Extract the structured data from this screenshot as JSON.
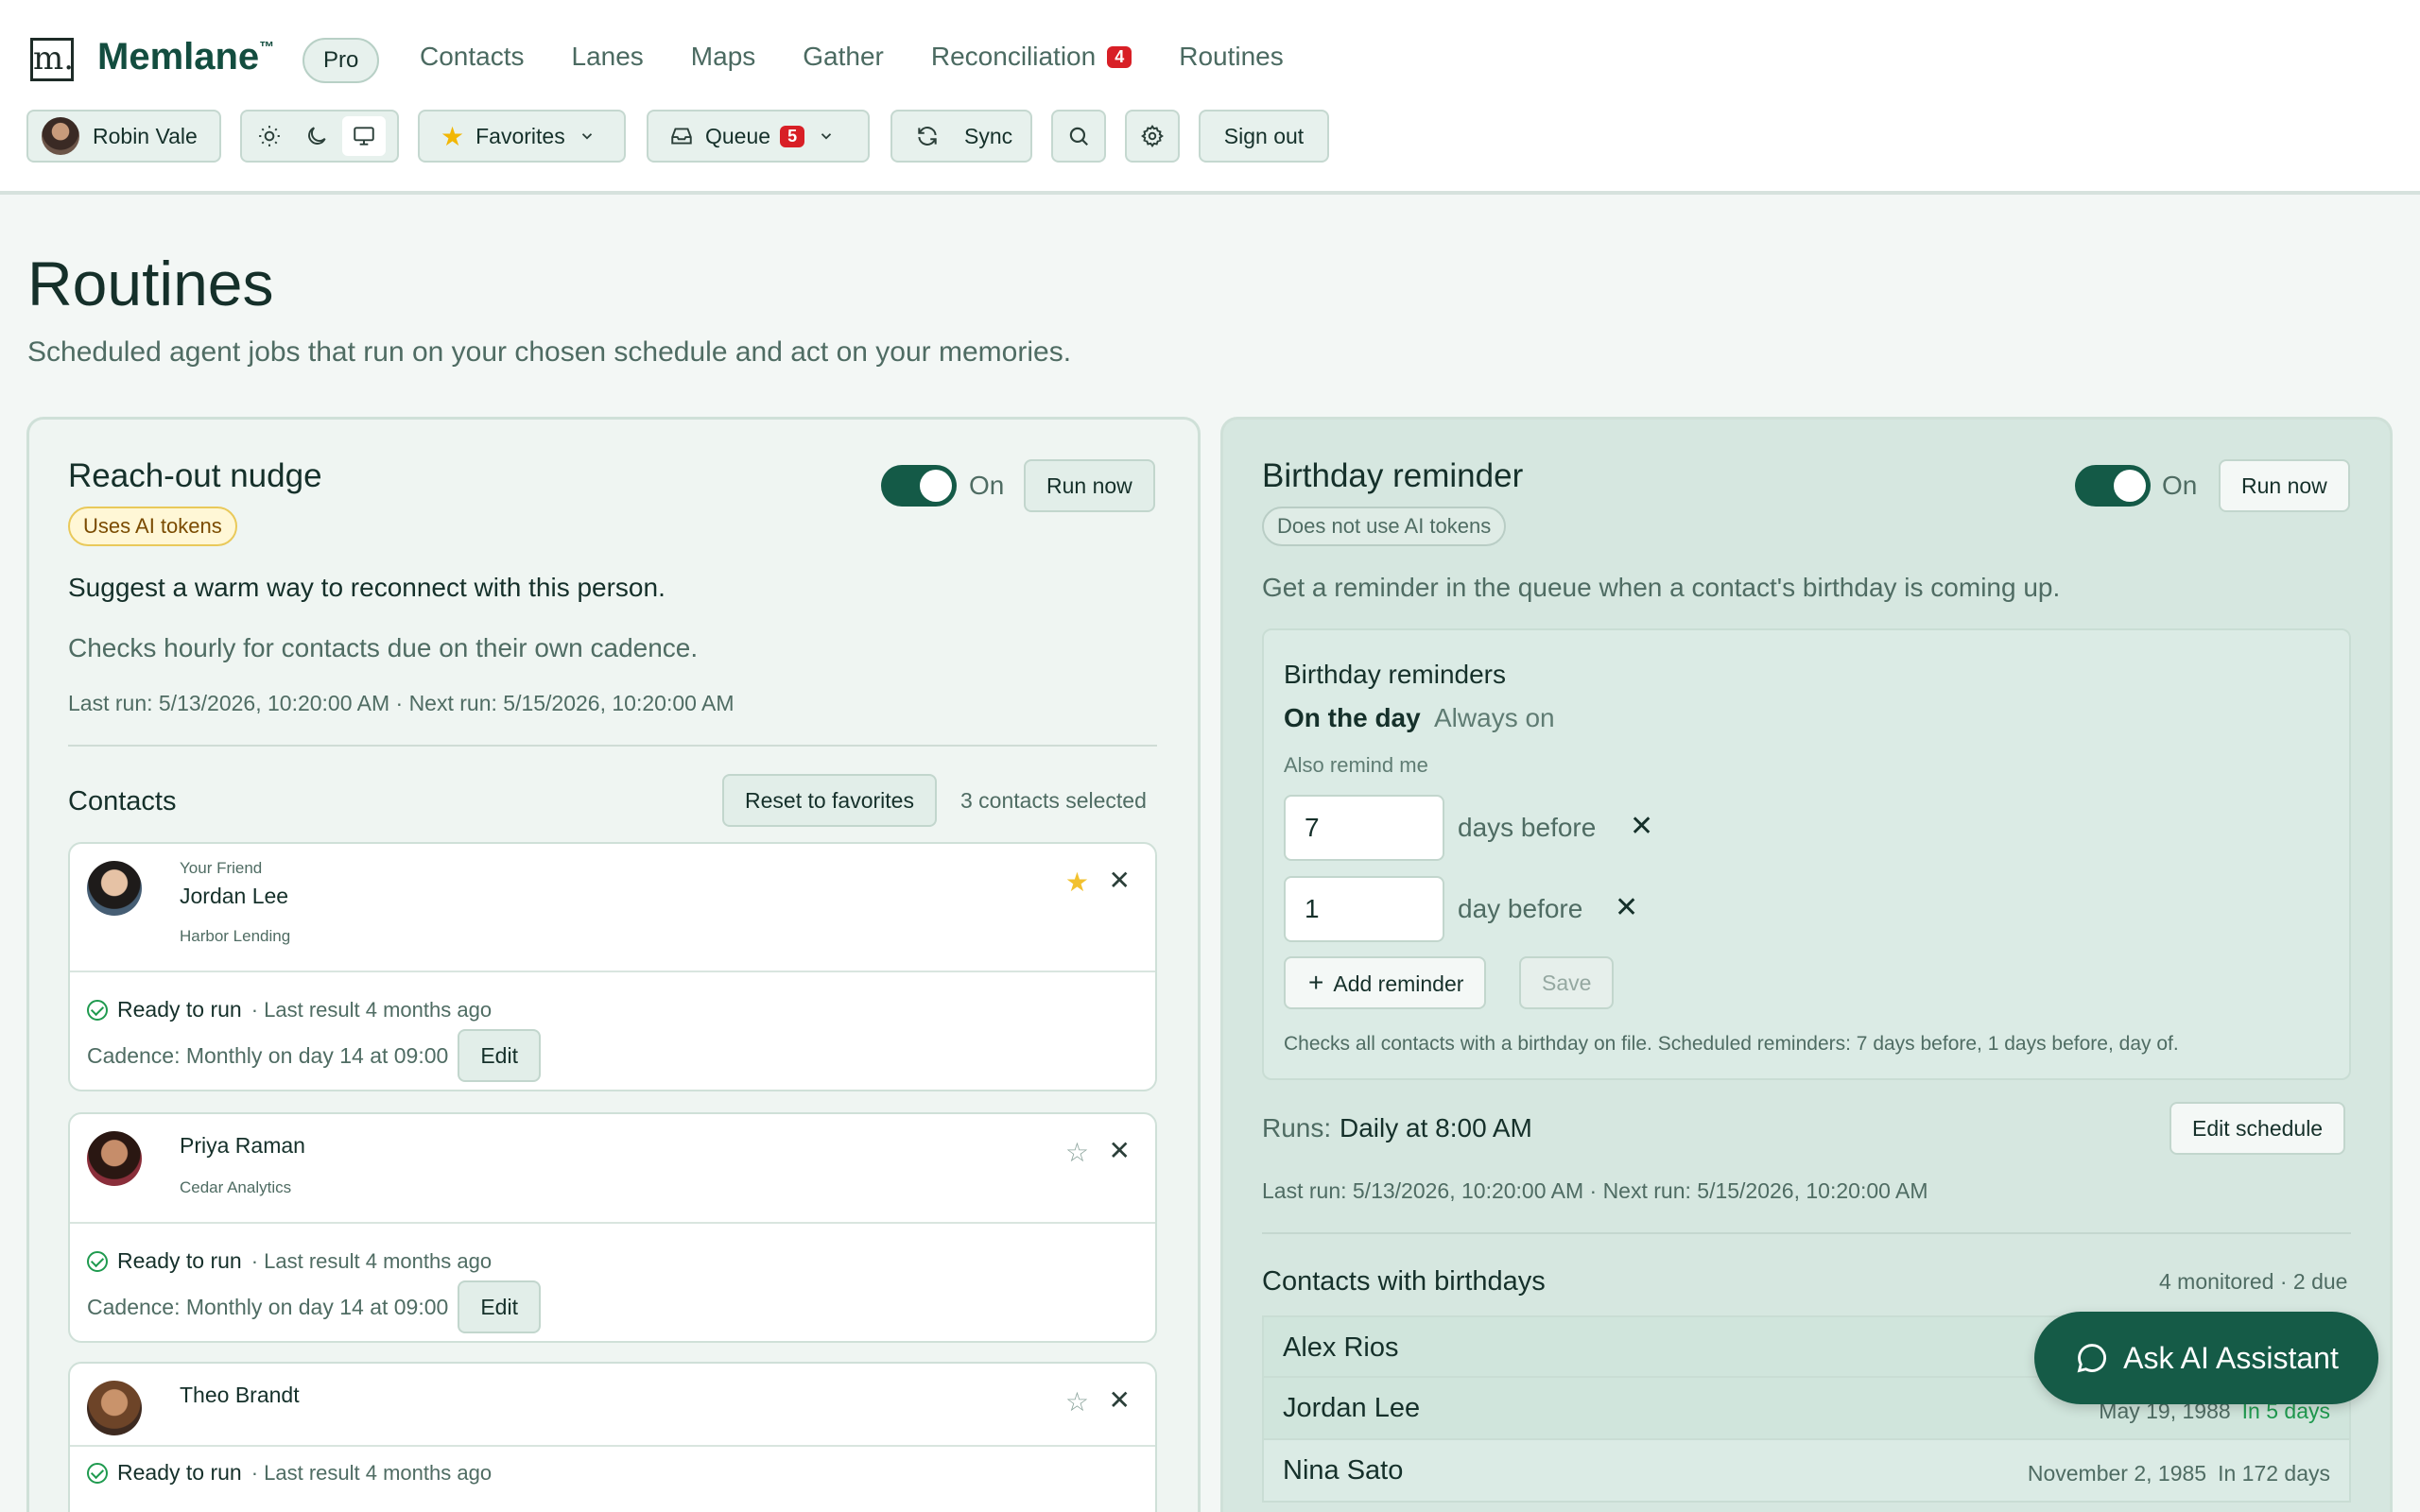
{
  "brand": {
    "logo_letter": "m.",
    "name": "Memlane",
    "tm": "™",
    "plan": "Pro"
  },
  "nav": [
    {
      "label": "Contacts"
    },
    {
      "label": "Lanes"
    },
    {
      "label": "Maps"
    },
    {
      "label": "Gather"
    },
    {
      "label": "Reconciliation",
      "count": "4"
    },
    {
      "label": "Routines"
    }
  ],
  "toolbar": {
    "user": "Robin Vale",
    "favorites": "Favorites",
    "queue": "Queue",
    "queue_count": "5",
    "sync": "Sync",
    "sign_out": "Sign out",
    "active_theme": "system"
  },
  "page": {
    "title": "Routines",
    "subtitle": "Scheduled agent jobs that run on your chosen schedule and act on your memories."
  },
  "reach_out": {
    "title": "Reach-out nudge",
    "token_badge": "Uses AI tokens",
    "toggle_label": "On",
    "run_now": "Run now",
    "description": "Suggest a warm way to reconnect with this person.",
    "check_info": "Checks hourly for contacts due on their own cadence.",
    "run_info": "Last run: 5/13/2026, 10:20:00 AM · Next run: 5/15/2026, 10:20:00 AM",
    "contacts_heading": "Contacts",
    "reset_label": "Reset to favorites",
    "selected_count": "3 contacts selected",
    "contacts": [
      {
        "relation": "Your Friend",
        "name": "Jordan Lee",
        "company": "Harbor Lending",
        "favorite": true,
        "status": "Ready to run",
        "last_result": "· Last result 4 months ago",
        "cadence": "Cadence: Monthly on day 14 at 09:00",
        "edit": "Edit"
      },
      {
        "relation": "",
        "name": "Priya Raman",
        "company": "Cedar Analytics",
        "favorite": false,
        "status": "Ready to run",
        "last_result": "· Last result 4 months ago",
        "cadence": "Cadence: Monthly on day 14 at 09:00",
        "edit": "Edit"
      },
      {
        "relation": "",
        "name": "Theo Brandt",
        "company": "",
        "favorite": false,
        "status": "Ready to run",
        "last_result": "· Last result 4 months ago"
      }
    ]
  },
  "birthday": {
    "title": "Birthday reminder",
    "token_badge": "Does not use AI tokens",
    "toggle_label": "On",
    "run_now": "Run now",
    "description": "Get a reminder in the queue when a contact's birthday is coming up.",
    "box_title": "Birthday reminders",
    "on_the_day": "On the day",
    "always_on": "Always on",
    "also_remind": "Also remind me",
    "reminders": [
      {
        "value": "7",
        "unit": "days before"
      },
      {
        "value": "1",
        "unit": "day before"
      }
    ],
    "add_reminder": "Add reminder",
    "save": "Save",
    "box_note": "Checks all contacts with a birthday on file. Scheduled reminders: 7 days before, 1 days before, day of.",
    "runs_label": "Runs:",
    "runs_value": "Daily at 8:00 AM",
    "edit_schedule": "Edit schedule",
    "run_info": "Last run: 5/13/2026, 10:20:00 AM · Next run: 5/15/2026, 10:20:00 AM",
    "list_heading": "Contacts with birthdays",
    "list_summary": "4 monitored · 2 due",
    "list": [
      {
        "name": "Alex Rios",
        "date": "",
        "in": ""
      },
      {
        "name": "Jordan Lee",
        "date": "May 19, 1988",
        "in": "In 5 days"
      },
      {
        "name": "Nina Sato",
        "date": "November 2, 1985",
        "in": "In 172 days"
      }
    ]
  },
  "assistant": {
    "label": "Ask AI Assistant"
  }
}
